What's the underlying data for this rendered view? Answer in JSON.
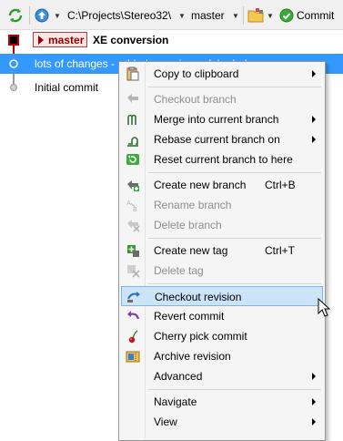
{
  "toolbar": {
    "path": "C:\\Projects\\Stereo32\\",
    "branch": "master",
    "commit_label": "Commit"
  },
  "graph": {
    "commits": [
      {
        "badge": "master",
        "message": "XE conversion"
      },
      {
        "message": "lots of changes - added generic module dad..."
      },
      {
        "message": "Initial commit"
      }
    ]
  },
  "menu": {
    "items": [
      {
        "label": "Copy to clipboard",
        "icon": "clipboard-icon",
        "submenu": true
      },
      {
        "label": "Checkout branch",
        "icon": "checkout-branch-icon",
        "disabled": true
      },
      {
        "label": "Merge into current branch",
        "icon": "merge-icon",
        "submenu": true
      },
      {
        "label": "Rebase current branch on",
        "icon": "rebase-icon",
        "submenu": true
      },
      {
        "label": "Reset current branch to here",
        "icon": "reset-icon"
      },
      {
        "label": "Create new branch",
        "icon": "create-branch-icon",
        "shortcut": "Ctrl+B"
      },
      {
        "label": "Rename branch",
        "icon": "rename-branch-icon",
        "disabled": true
      },
      {
        "label": "Delete branch",
        "icon": "delete-branch-icon",
        "disabled": true
      },
      {
        "label": "Create new tag",
        "icon": "create-tag-icon",
        "shortcut": "Ctrl+T"
      },
      {
        "label": "Delete tag",
        "icon": "delete-tag-icon",
        "disabled": true
      },
      {
        "label": "Checkout revision",
        "icon": "checkout-revision-icon",
        "highlighted": true
      },
      {
        "label": "Revert commit",
        "icon": "revert-icon"
      },
      {
        "label": "Cherry pick commit",
        "icon": "cherry-icon"
      },
      {
        "label": "Archive revision",
        "icon": "archive-icon"
      },
      {
        "label": "Advanced",
        "icon": "none",
        "submenu": true
      },
      {
        "label": "Navigate",
        "icon": "none",
        "submenu": true
      },
      {
        "label": "View",
        "icon": "none",
        "submenu": true
      }
    ]
  },
  "colors": {
    "selection": "#3399ff",
    "branch_red": "#8b0000",
    "menu_highlight": "#cce4f7"
  }
}
